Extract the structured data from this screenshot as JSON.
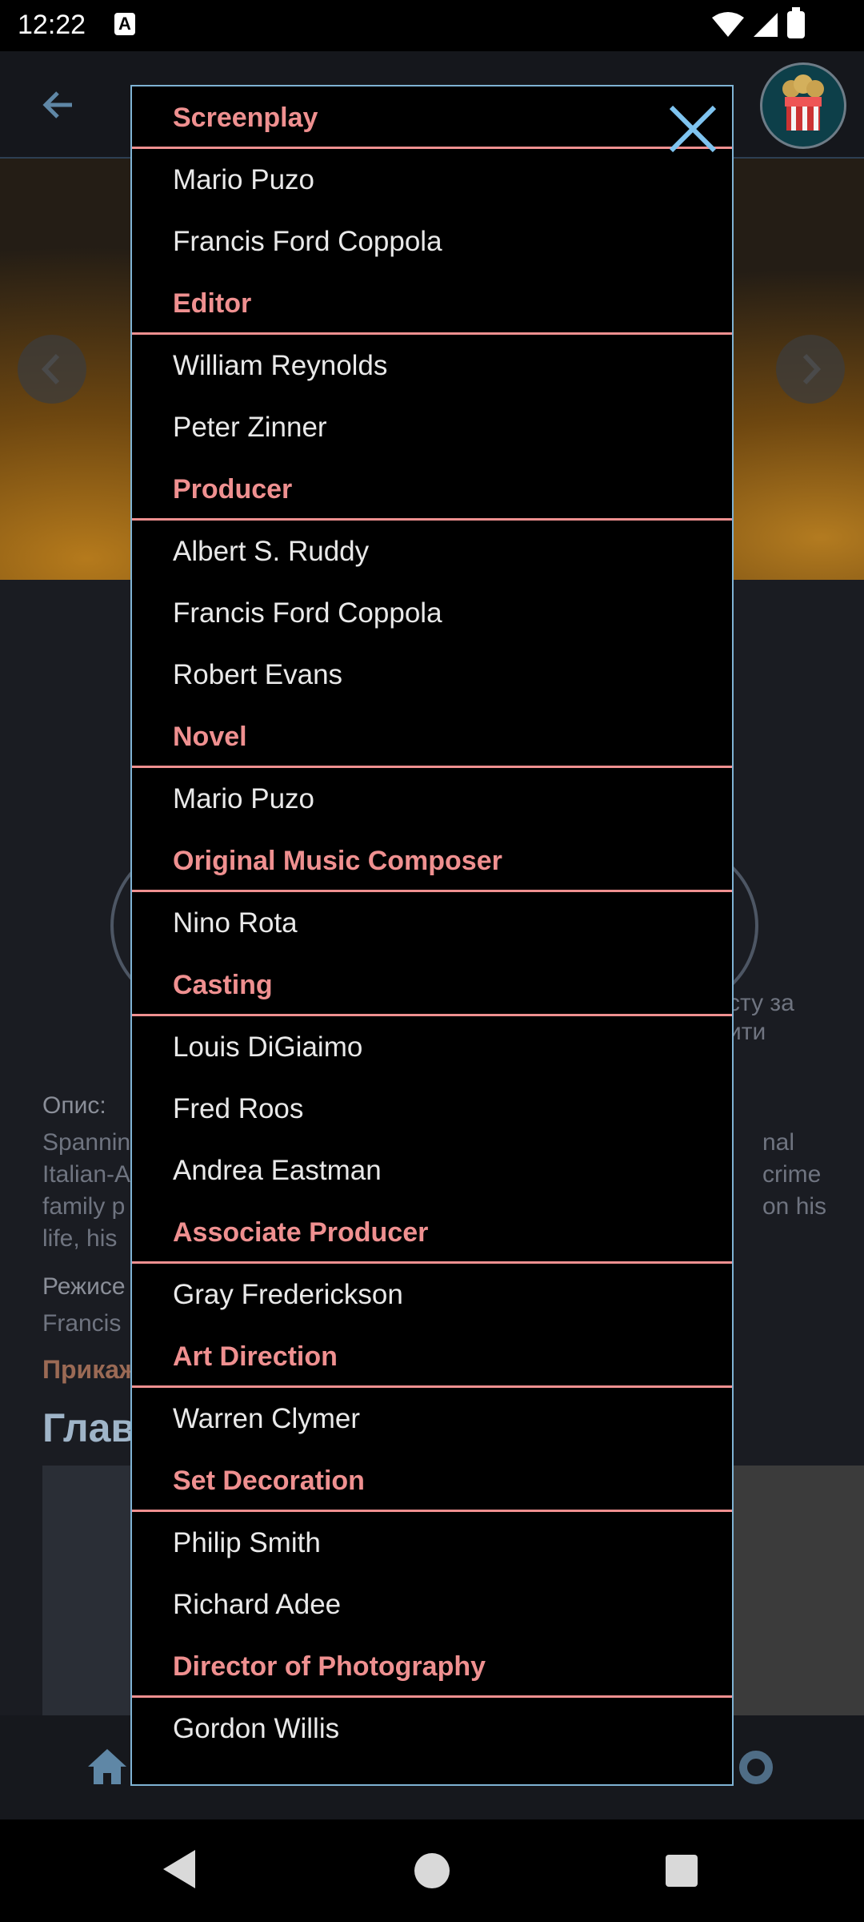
{
  "status": {
    "time": "12:22",
    "notif_label": "A"
  },
  "background": {
    "desc_label": "Опис:",
    "desc_lines_left": [
      "Spannin",
      "Italian-A",
      "family p",
      "life, his"
    ],
    "desc_lines_right": [
      "nal",
      "crime",
      "on his"
    ],
    "side_lines": [
      "сту за",
      "ити"
    ],
    "director_label": "Режисе",
    "director_name": "Francis",
    "hidden_label": "Прикаж",
    "section_title": "Глав"
  },
  "dialog": {
    "groups": [
      {
        "title": "Screenplay",
        "people": [
          "Mario Puzo",
          "Francis Ford Coppola"
        ]
      },
      {
        "title": "Editor",
        "people": [
          "William Reynolds",
          "Peter Zinner"
        ]
      },
      {
        "title": "Producer",
        "people": [
          "Albert S. Ruddy",
          "Francis Ford Coppola",
          "Robert Evans"
        ]
      },
      {
        "title": "Novel",
        "people": [
          "Mario Puzo"
        ]
      },
      {
        "title": "Original Music Composer",
        "people": [
          "Nino Rota"
        ]
      },
      {
        "title": "Casting",
        "people": [
          "Louis DiGiaimo",
          "Fred Roos",
          "Andrea Eastman"
        ]
      },
      {
        "title": "Associate Producer",
        "people": [
          "Gray Frederickson"
        ]
      },
      {
        "title": "Art Direction",
        "people": [
          "Warren Clymer"
        ]
      },
      {
        "title": "Set Decoration",
        "people": [
          "Philip Smith",
          "Richard Adee"
        ]
      },
      {
        "title": "Director of Photography",
        "people": [
          "Gordon Willis"
        ]
      }
    ]
  },
  "colors": {
    "section_title": "#ef9090",
    "dialog_border": "#7fb3d4",
    "close_icon": "#7fc4f0"
  },
  "icons": [
    "back-arrow-icon",
    "close-icon",
    "home-icon",
    "settings-icon",
    "chevron-left-icon",
    "chevron-right-icon"
  ]
}
